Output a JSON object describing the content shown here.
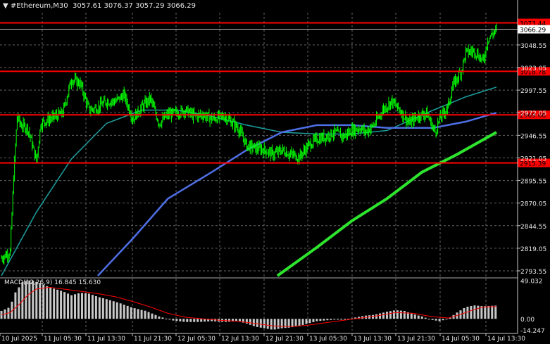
{
  "header": {
    "symbol": "#Ethereum,M30",
    "ohlc": "3057.61 3076.37 3057.29 3066.29"
  },
  "macd_title": "MACD(12,26,9) 16.845 15.630",
  "colors": {
    "background": "#000000",
    "candle": "#00ff00",
    "grid": "#646464",
    "hline": "#ff0000",
    "ma_teal": "#1f9e9e",
    "ma_blue": "#4f6fe6",
    "ma_green": "#2ee52e",
    "macd_hist": "#c8c8c8",
    "macd_signal": "#ff0000",
    "price_tag": "#ffffff"
  },
  "chart_data": [
    {
      "type": "candlestick",
      "symbol": "#Ethereum",
      "timeframe": "M30",
      "current_price": "3066.29",
      "ylim": [
        2788,
        3085
      ],
      "y_ticks": [
        "3048.55",
        "3023.05",
        "2997.55",
        "2972.05",
        "2946.55",
        "2921.05",
        "2895.55",
        "2870.05",
        "2844.55",
        "2819.05",
        "2793.55"
      ],
      "x_ticks": [
        "10 Jul 2025",
        "11 Jul 05:30",
        "11 Jul 13:30",
        "11 Jul 21:30",
        "12 Jul 05:30",
        "12 Jul 13:30",
        "12 Jul 21:30",
        "13 Jul 05:30",
        "13 Jul 13:30",
        "13 Jul 21:30",
        "14 Jul 05:30",
        "14 Jul 13:30"
      ],
      "horizontal_levels": [
        {
          "label": "3073.44",
          "value": 3073.44
        },
        {
          "label": "3018.78",
          "value": 3018.78
        },
        {
          "label": "2969.66",
          "value": 2969.66
        },
        {
          "label": "2915.39",
          "value": 2915.39
        }
      ],
      "moving_averages": [
        {
          "color": "#1f9e9e",
          "anchors": [
            [
              0,
              2788
            ],
            [
              40,
              2860
            ],
            [
              80,
              2920
            ],
            [
              120,
              2960
            ],
            [
              160,
              2975
            ],
            [
              200,
              2975
            ],
            [
              240,
              2968
            ],
            [
              280,
              2958
            ],
            [
              320,
              2950
            ],
            [
              360,
              2948
            ],
            [
              400,
              2948
            ],
            [
              440,
              2952
            ],
            [
              470,
              2965
            ],
            [
              493,
              2975
            ],
            [
              530,
              2990
            ],
            [
              565,
              3001
            ]
          ]
        },
        {
          "color": "#4f6fe6",
          "anchors": [
            [
              110,
              2788
            ],
            [
              150,
              2830
            ],
            [
              190,
              2875
            ],
            [
              240,
              2905
            ],
            [
              280,
              2930
            ],
            [
              320,
              2950
            ],
            [
              360,
              2958
            ],
            [
              400,
              2958
            ],
            [
              440,
              2955
            ],
            [
              470,
              2955
            ],
            [
              493,
              2955
            ],
            [
              530,
              2962
            ],
            [
              565,
              2972
            ]
          ]
        },
        {
          "color": "#2ee52e",
          "anchors": [
            [
              315,
              2788
            ],
            [
              360,
              2820
            ],
            [
              400,
              2850
            ],
            [
              440,
              2875
            ],
            [
              480,
              2905
            ],
            [
              520,
              2925
            ],
            [
              565,
              2950
            ]
          ]
        }
      ],
      "candles_anchors": [
        [
          0,
          2808
        ],
        [
          10,
          2815
        ],
        [
          14,
          2900
        ],
        [
          18,
          2968
        ],
        [
          22,
          2958
        ],
        [
          30,
          2955
        ],
        [
          40,
          2918
        ],
        [
          45,
          2960
        ],
        [
          55,
          2965
        ],
        [
          70,
          2972
        ],
        [
          80,
          3010
        ],
        [
          90,
          3005
        ],
        [
          100,
          2975
        ],
        [
          110,
          2978
        ],
        [
          120,
          2985
        ],
        [
          130,
          2985
        ],
        [
          140,
          2992
        ],
        [
          150,
          2965
        ],
        [
          160,
          2978
        ],
        [
          170,
          2988
        ],
        [
          180,
          2960
        ],
        [
          190,
          2970
        ],
        [
          200,
          2972
        ],
        [
          210,
          2975
        ],
        [
          220,
          2968
        ],
        [
          230,
          2970
        ],
        [
          240,
          2965
        ],
        [
          255,
          2968
        ],
        [
          270,
          2955
        ],
        [
          280,
          2935
        ],
        [
          290,
          2932
        ],
        [
          300,
          2930
        ],
        [
          310,
          2925
        ],
        [
          320,
          2930
        ],
        [
          330,
          2925
        ],
        [
          340,
          2922
        ],
        [
          350,
          2935
        ],
        [
          360,
          2942
        ],
        [
          370,
          2945
        ],
        [
          380,
          2950
        ],
        [
          390,
          2945
        ],
        [
          400,
          2952
        ],
        [
          410,
          2955
        ],
        [
          415,
          2950
        ],
        [
          425,
          2958
        ],
        [
          435,
          2975
        ],
        [
          445,
          2985
        ],
        [
          455,
          2975
        ],
        [
          465,
          2960
        ],
        [
          475,
          2968
        ],
        [
          485,
          2972
        ],
        [
          495,
          2950
        ],
        [
          500,
          2965
        ],
        [
          510,
          2980
        ],
        [
          515,
          3002
        ],
        [
          525,
          3020
        ],
        [
          530,
          3040
        ],
        [
          540,
          3042
        ],
        [
          550,
          3030
        ],
        [
          555,
          3055
        ],
        [
          565,
          3066.29
        ]
      ]
    },
    {
      "type": "bar",
      "name": "MACD",
      "params": "12,26,9",
      "values_label": "16.845 15.630",
      "main": 16.845,
      "signal": 15.63,
      "ylim": [
        -15,
        52
      ],
      "y_ticks": [
        "49.032",
        "0.00",
        "-14.247"
      ],
      "hist_anchors": [
        [
          0,
          10
        ],
        [
          10,
          15
        ],
        [
          15,
          32
        ],
        [
          25,
          48
        ],
        [
          35,
          49
        ],
        [
          45,
          45
        ],
        [
          55,
          40
        ],
        [
          70,
          35
        ],
        [
          80,
          30
        ],
        [
          90,
          33
        ],
        [
          100,
          32
        ],
        [
          110,
          28
        ],
        [
          120,
          25
        ],
        [
          135,
          20
        ],
        [
          150,
          14
        ],
        [
          165,
          10
        ],
        [
          180,
          3
        ],
        [
          195,
          -2
        ],
        [
          210,
          -4
        ],
        [
          225,
          -4
        ],
        [
          240,
          -3
        ],
        [
          255,
          -4
        ],
        [
          270,
          -3
        ],
        [
          280,
          -6
        ],
        [
          290,
          -10
        ],
        [
          300,
          -12
        ],
        [
          310,
          -14
        ],
        [
          320,
          -12
        ],
        [
          330,
          -11
        ],
        [
          340,
          -9
        ],
        [
          350,
          -6
        ],
        [
          360,
          -3
        ],
        [
          370,
          -2
        ],
        [
          380,
          -1
        ],
        [
          395,
          -1
        ],
        [
          405,
          2
        ],
        [
          415,
          4
        ],
        [
          425,
          5
        ],
        [
          440,
          9
        ],
        [
          450,
          11
        ],
        [
          460,
          10
        ],
        [
          470,
          6
        ],
        [
          480,
          3
        ],
        [
          490,
          -1
        ],
        [
          500,
          -3
        ],
        [
          510,
          0
        ],
        [
          520,
          8
        ],
        [
          530,
          15
        ],
        [
          540,
          17
        ],
        [
          550,
          16
        ],
        [
          565,
          16.845
        ]
      ],
      "signal_anchors": [
        [
          0,
          5
        ],
        [
          10,
          8
        ],
        [
          20,
          18
        ],
        [
          30,
          30
        ],
        [
          40,
          38
        ],
        [
          55,
          40
        ],
        [
          70,
          38
        ],
        [
          90,
          35
        ],
        [
          110,
          32
        ],
        [
          130,
          28
        ],
        [
          150,
          22
        ],
        [
          170,
          15
        ],
        [
          190,
          7
        ],
        [
          210,
          2
        ],
        [
          230,
          0
        ],
        [
          250,
          -2
        ],
        [
          270,
          -3
        ],
        [
          290,
          -6
        ],
        [
          310,
          -9
        ],
        [
          330,
          -10
        ],
        [
          350,
          -8
        ],
        [
          370,
          -5
        ],
        [
          390,
          -2
        ],
        [
          410,
          1
        ],
        [
          430,
          4
        ],
        [
          450,
          8
        ],
        [
          470,
          7
        ],
        [
          490,
          3
        ],
        [
          510,
          1
        ],
        [
          525,
          6
        ],
        [
          540,
          12
        ],
        [
          550,
          15
        ],
        [
          565,
          15.63
        ]
      ]
    }
  ]
}
